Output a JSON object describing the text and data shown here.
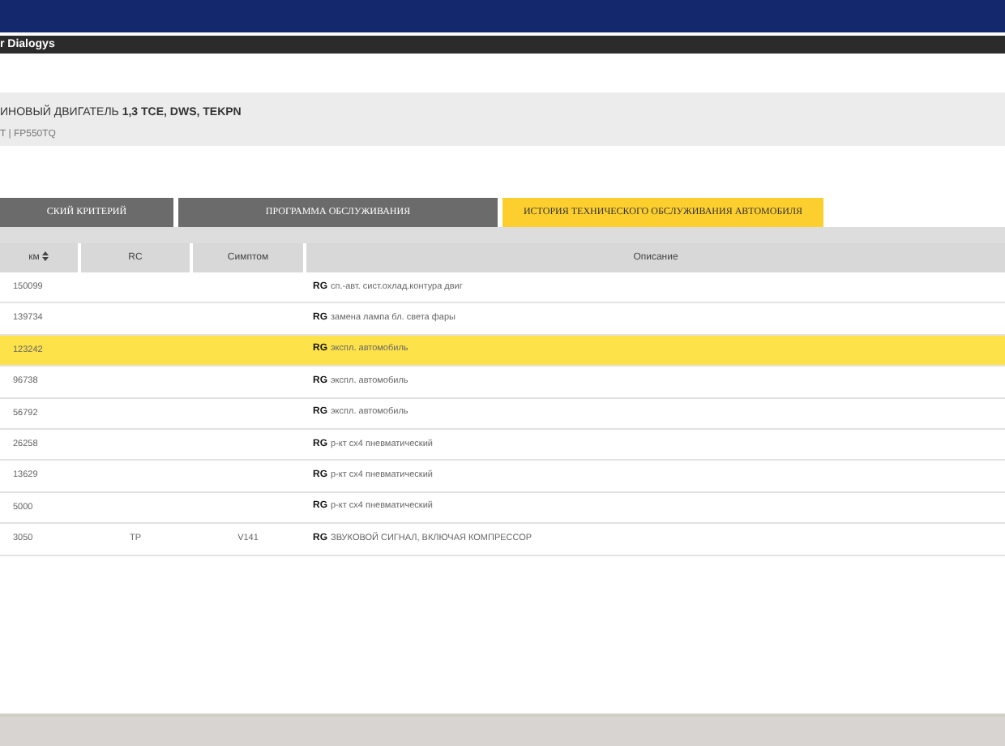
{
  "app_bar": {
    "title": "r Dialogys"
  },
  "vehicle": {
    "title": "ИНОВЫЙ ДВИГАТЕЛЬ **1,3 TCE, DWS, TEKPN**",
    "subtitle": "T | FP550TQ"
  },
  "tabs": [
    {
      "label": "СКИЙ КРИТЕРИЙ",
      "selected": false
    },
    {
      "label": "ПРОГРАММА ОБСЛУЖИВАНИЯ",
      "selected": false
    },
    {
      "label": "ИСТОРИЯ ТЕХНИЧЕСКОГО ОБСЛУЖИВАНИЯ АВТОМОБИЛЯ",
      "selected": true
    }
  ],
  "table": {
    "columns": [
      "км",
      "RC",
      "Симптом",
      "Описание"
    ],
    "rows": [
      {
        "km": "150099",
        "rc": "",
        "symptom": "",
        "tag": "RG",
        "description": "сп.-авт. сист.охлад.контура двиг",
        "selected": false
      },
      {
        "km": "139734",
        "rc": "",
        "symptom": "",
        "tag": "RG",
        "description": "замена лампа бл. света фары",
        "selected": false
      },
      {
        "km": "123242",
        "rc": "",
        "symptom": "",
        "tag": "RG",
        "description": "экспл. автомобиль",
        "selected": true
      },
      {
        "km": "96738",
        "rc": "",
        "symptom": "",
        "tag": "RG",
        "description": "экспл. автомобиль",
        "selected": false
      },
      {
        "km": "56792",
        "rc": "",
        "symptom": "",
        "tag": "RG",
        "description": "экспл. автомобиль",
        "selected": false
      },
      {
        "km": "26258",
        "rc": "",
        "symptom": "",
        "tag": "RG",
        "description": "р-кт сх4 пневматический",
        "selected": false
      },
      {
        "km": "13629",
        "rc": "",
        "symptom": "",
        "tag": "RG",
        "description": "р-кт сх4 пневматический",
        "selected": false
      },
      {
        "km": "5000",
        "rc": "",
        "symptom": "",
        "tag": "RG",
        "description": "р-кт сх4 пневматический",
        "selected": false
      },
      {
        "km": "3050",
        "rc": "TP",
        "symptom": "V141",
        "tag": "RG",
        "description": "ЗВУКОВОЙ СИГНАЛ, ВКЛЮЧАЯ КОМПРЕССОР",
        "selected": false
      }
    ]
  }
}
